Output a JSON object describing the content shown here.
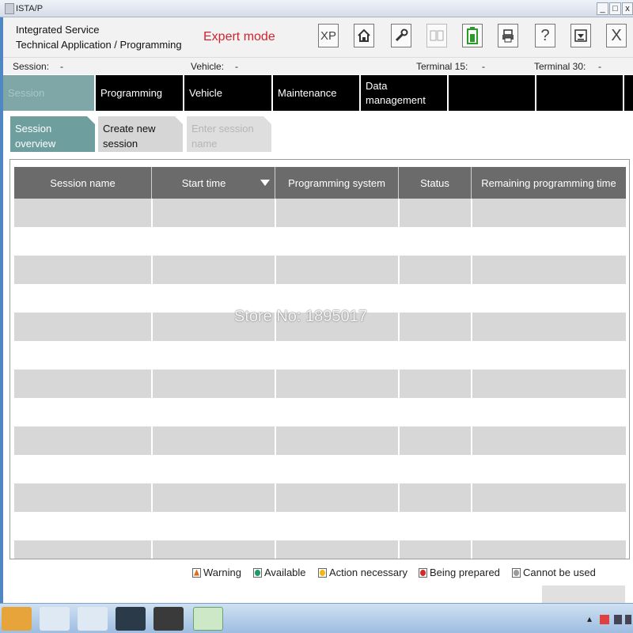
{
  "window": {
    "title": "ISTA/P",
    "minimize": "_",
    "maximize": "□",
    "close": "x"
  },
  "header": {
    "line1": "Integrated Service",
    "line2": "Technical Application / Programming",
    "mode": "Expert mode",
    "toolbar": {
      "xp": "XP",
      "help": "?",
      "close": "X"
    }
  },
  "info": {
    "session_label": "Session:",
    "session_value": "-",
    "vehicle_label": "Vehicle:",
    "vehicle_value": "-",
    "terminal15_label": "Terminal 15:",
    "terminal15_value": "-",
    "terminal30_label": "Terminal 30:",
    "terminal30_value": "-"
  },
  "nav": {
    "tabs": [
      {
        "label": "Session"
      },
      {
        "label": "Programming"
      },
      {
        "label": "Vehicle"
      },
      {
        "label": "Maintenance"
      },
      {
        "label": "Data management"
      }
    ]
  },
  "subtabs": [
    {
      "label": "Session overview"
    },
    {
      "label": "Create new session"
    },
    {
      "label": "Enter session name"
    }
  ],
  "table": {
    "columns": [
      "Session name",
      "Start time",
      "Programming system",
      "Status",
      "Remaining programming time"
    ]
  },
  "watermark": "Store No: 1895017",
  "legend": [
    {
      "label": "Warning",
      "color": "#e06a1a"
    },
    {
      "label": "Available",
      "color": "#1c9a6a"
    },
    {
      "label": "Action necessary",
      "color": "#f2b818"
    },
    {
      "label": "Being prepared",
      "color": "#d42a2a"
    },
    {
      "label": "Cannot be used",
      "color": "#9c9c9c"
    }
  ],
  "colors": {
    "accent": "#6f9e9e",
    "nav_bg": "#000000",
    "header_row": "#6b6b6b",
    "mode_red": "#d0232b"
  }
}
